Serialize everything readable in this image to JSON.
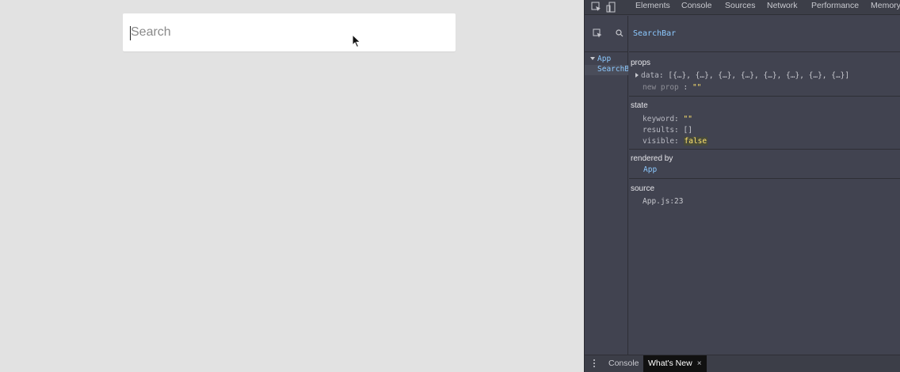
{
  "app": {
    "search": {
      "placeholder": "Search",
      "value": ""
    }
  },
  "devtools": {
    "tabs": [
      "Elements",
      "Console",
      "Sources",
      "Network",
      "Performance",
      "Memory"
    ],
    "tree": {
      "root": "App",
      "selected": "SearchBar"
    },
    "component": {
      "name": "SearchBar",
      "props_title": "props",
      "props": {
        "data_key": "data",
        "data_value": "[{…}, {…}, {…}, {…}, {…}, {…}, {…}, {…}]",
        "new_prop_key": "new prop",
        "new_prop_value": "\"\""
      },
      "state_title": "state",
      "state": [
        {
          "key": "keyword",
          "value": "\"\""
        },
        {
          "key": "results",
          "value": "[]"
        },
        {
          "key": "visible",
          "value": "false"
        }
      ],
      "rendered_by_title": "rendered by",
      "rendered_by": "App",
      "source_title": "source",
      "source": "App.js:23"
    },
    "drawer": {
      "tabs": [
        "Console",
        "What's New"
      ],
      "active": "What's New",
      "close": "×"
    },
    "colors": {
      "accent": "#8cc9ff",
      "string": "#ffe36e",
      "panel_bg": "#414350"
    }
  }
}
